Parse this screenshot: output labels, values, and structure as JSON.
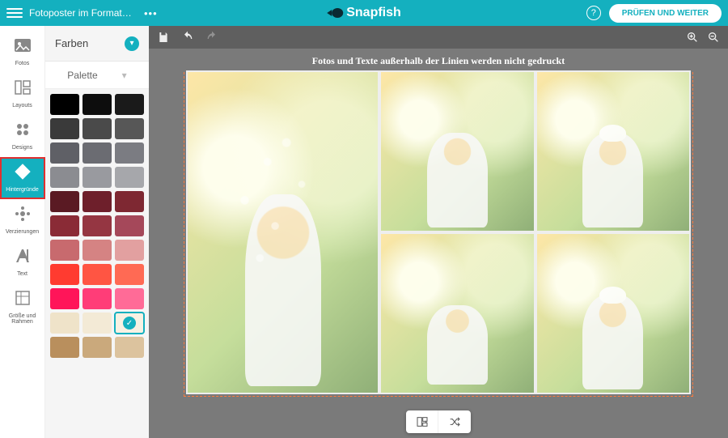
{
  "header": {
    "project_title": "Fotoposter im Format 3…",
    "more": "•••",
    "brand": "Snapfish",
    "help": "?",
    "cta_label": "PRÜFEN UND WEITER"
  },
  "tool_rail": {
    "items": [
      {
        "id": "fotos",
        "label": "Fotos"
      },
      {
        "id": "layouts",
        "label": "Layouts"
      },
      {
        "id": "designs",
        "label": "Designs"
      },
      {
        "id": "hintergruende",
        "label": "Hintergründe",
        "active": true
      },
      {
        "id": "verzierungen",
        "label": "Verzierungen"
      },
      {
        "id": "text",
        "label": "Text"
      },
      {
        "id": "groesse",
        "label": "Größe und Rahmen"
      }
    ]
  },
  "panel": {
    "title": "Farben",
    "subtitle": "Palette",
    "palette": [
      [
        "#000000",
        "#0d0d0d",
        "#1a1a1a"
      ],
      [
        "#3a3a3a",
        "#4a4a4a",
        "#575757"
      ],
      [
        "#5f6066",
        "#6b6c72",
        "#7b7c82"
      ],
      [
        "#8b8c91",
        "#999a9f",
        "#a6a7ab"
      ],
      [
        "#5a1a23",
        "#6e1f2b",
        "#7e2832"
      ],
      [
        "#8a2b36",
        "#953642",
        "#a5485a"
      ],
      [
        "#c86a6e",
        "#d58383",
        "#e2a0a0"
      ],
      [
        "#ff3b30",
        "#ff5543",
        "#ff6a54"
      ],
      [
        "#ff1559",
        "#ff3d78",
        "#ff6b97"
      ],
      [
        "#efe3c9",
        "#f3ead6",
        "#f7f1e3"
      ],
      [
        "#b98f5d",
        "#caa97c",
        "#dcc39e"
      ]
    ],
    "selected": [
      9,
      2
    ]
  },
  "canvas": {
    "hint": "Fotos und Texte außerhalb der Linien werden nicht gedruckt"
  }
}
